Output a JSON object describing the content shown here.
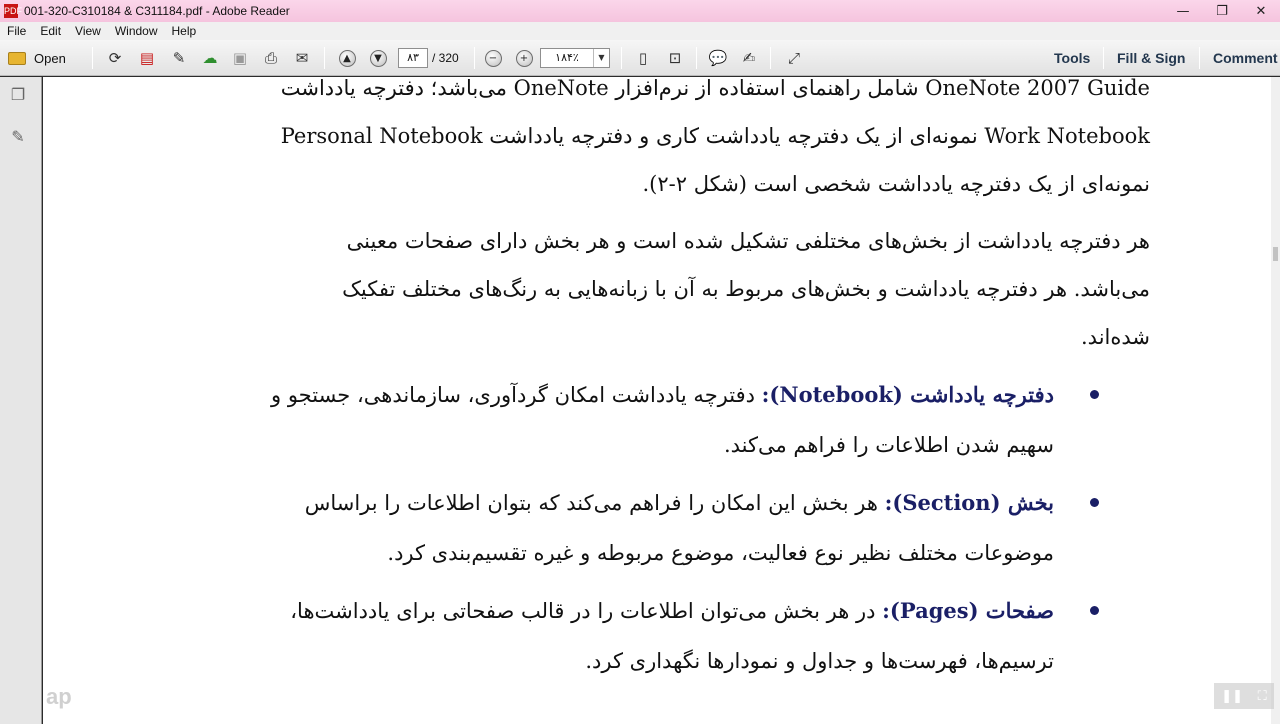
{
  "window": {
    "title": "001-320-C310184 & C311184.pdf - Adobe Reader",
    "app_icon_text": "PDF",
    "controls": {
      "minimize": "—",
      "restore": "❐",
      "close": "✕"
    }
  },
  "menu": [
    "File",
    "Edit",
    "View",
    "Window",
    "Help"
  ],
  "toolbar": {
    "open_label": "Open",
    "page_current": "۸۳",
    "page_total": "/ 320",
    "zoom": "۱۸۴٪",
    "tools_label": "Tools",
    "fill_sign_label": "Fill & Sign",
    "comment_label": "Comment"
  },
  "document": {
    "para1": [
      "OneNote 2007 Guide شامل راهنمای استفاده از نرم‌افزار OneNote می‌باشد؛ دفترچه یادداشت",
      "Work Notebook نمونه‌ای از یک دفترچه یادداشت کاری و دفترچه یادداشت Personal Notebook",
      "نمونه‌ای از یک دفترچه یادداشت شخصی است (شکل ۲-۲)."
    ],
    "para2": [
      "هر دفترچه یادداشت از بخش‌های مختلفی تشکیل شده است و هر بخش دارای صفحات معینی",
      "می‌باشد. هر دفترچه یادداشت و بخش‌های مربوط به آن با زبانه‌هایی به رنگ‌های مختلف تفکیک",
      "شده‌اند."
    ],
    "bullets": [
      {
        "term": "دفترچه یادداشت (Notebook):",
        "line1": " دفترچه یادداشت امکان گردآوری، سازماندهی، جستجو و",
        "line2": "سهیم شدن اطلاعات را فراهم می‌کند."
      },
      {
        "term": "بخش (Section):",
        "line1": " هر بخش این امکان را فراهم می‌کند که بتوان اطلاعات را براساس",
        "line2": "موضوعات مختلف نظیر نوع فعالیت، موضوع مربوطه و غیره تقسیم‌بندی کرد."
      },
      {
        "term": "صفحات (Pages):",
        "line1": " در هر بخش می‌توان اطلاعات را در قالب صفحاتی برای یادداشت‌ها،",
        "line2": "ترسیم‌ها، فهرست‌ها و جداول و نمودارها نگهداری کرد."
      }
    ]
  },
  "overlay": {
    "watermark": "ap",
    "pause": "❚❚",
    "expand": "⛶"
  },
  "colors": {
    "titlebar": "#f5c4de",
    "bullet_term": "#1a1f66"
  }
}
